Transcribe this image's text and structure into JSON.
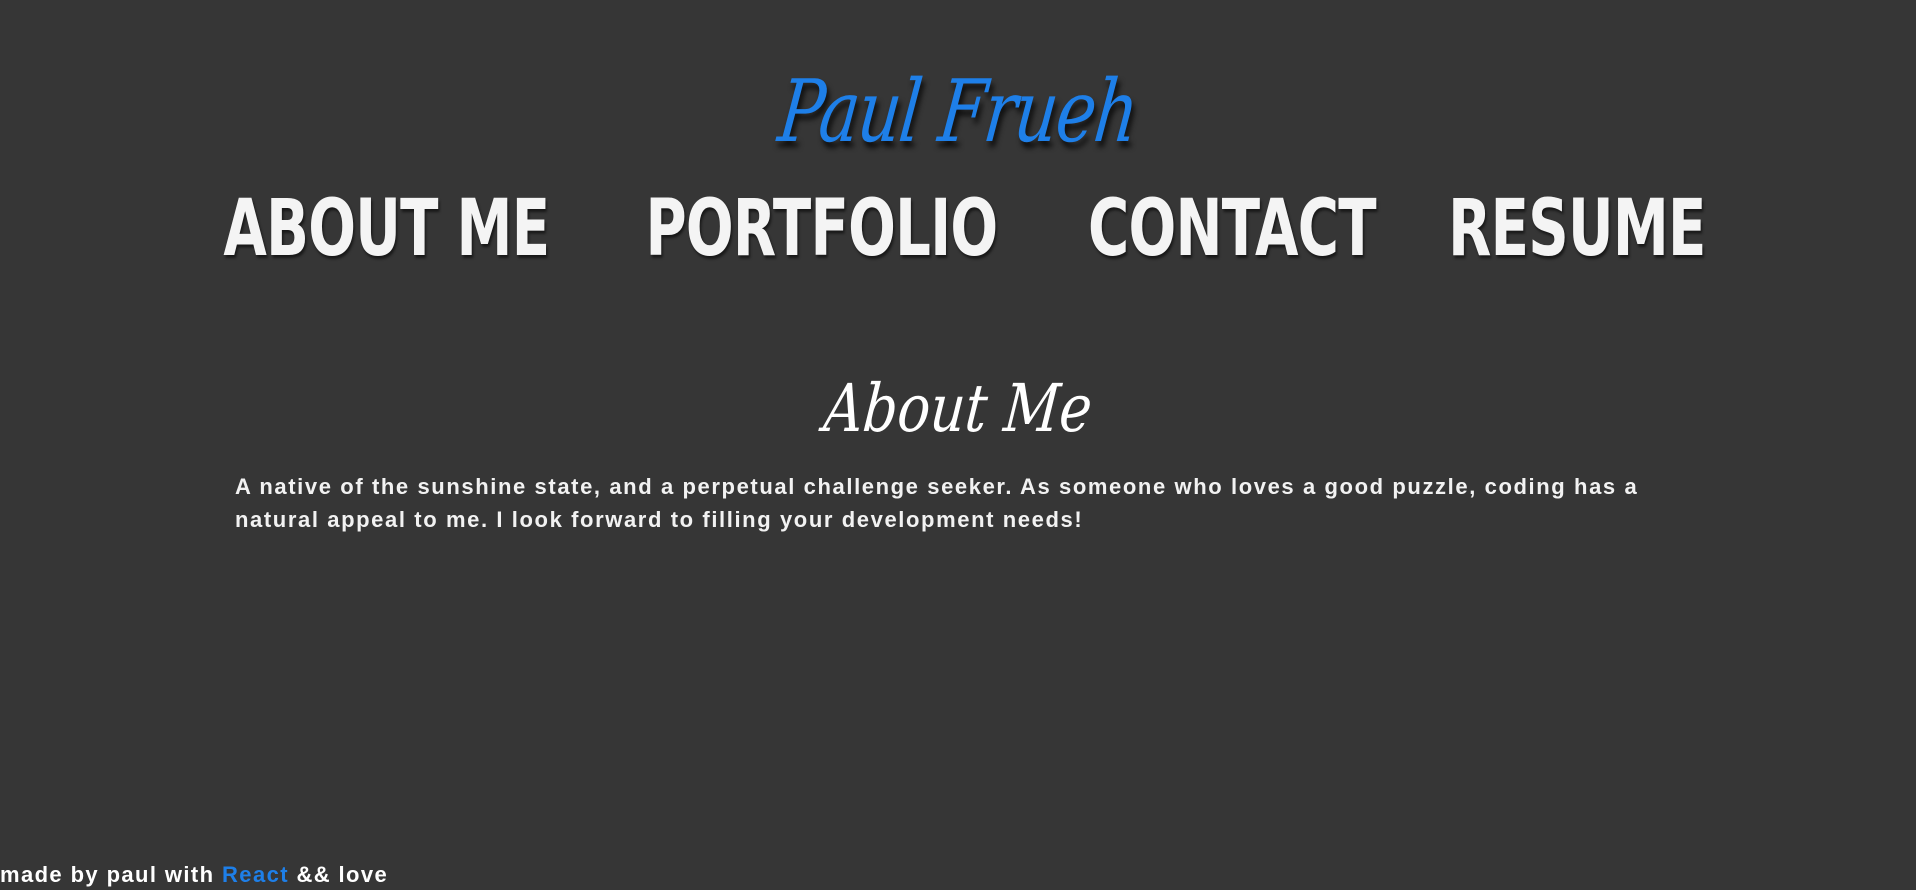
{
  "header": {
    "site_title": "Paul Frueh",
    "nav": [
      {
        "label": "ABOUT ME"
      },
      {
        "label": "PORTFOLIO"
      },
      {
        "label": "CONTACT"
      },
      {
        "label": "RESUME"
      }
    ]
  },
  "main": {
    "section_title": "About Me",
    "about_text": "A native of the sunshine state, and a perpetual challenge seeker. As someone who loves a good puzzle, coding has a natural appeal to me. I look forward to filling your development needs!"
  },
  "footer": {
    "prefix": "made by paul with ",
    "react_label": "React",
    "suffix": " && love"
  },
  "colors": {
    "background": "#363636",
    "accent": "#1e7fe8",
    "text": "#ffffff"
  }
}
